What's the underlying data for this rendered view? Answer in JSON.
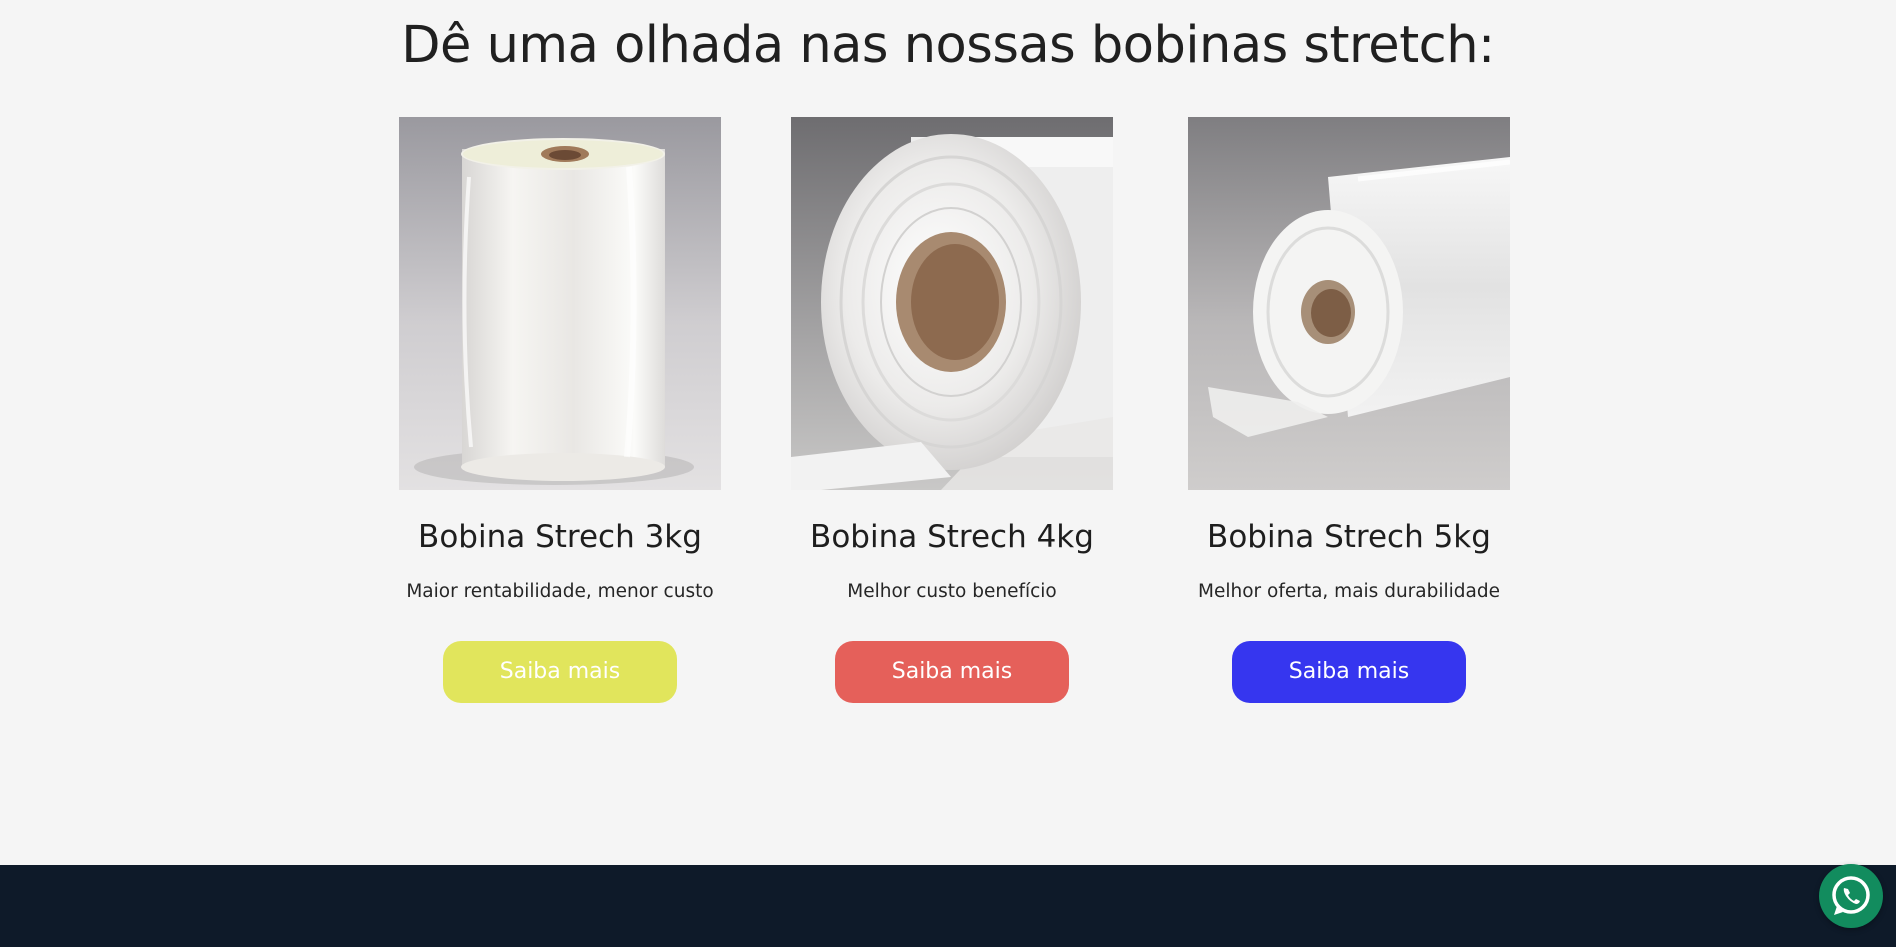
{
  "section": {
    "heading": "Dê uma olhada nas nossas bobinas stretch:"
  },
  "products": [
    {
      "name": "Bobina Strech 3kg",
      "description": "Maior rentabilidade, menor custo",
      "button_label": "Saiba mais",
      "button_color": "#e1e55c",
      "image_icon": "upright-stretch-film-roll"
    },
    {
      "name": "Bobina Strech 4kg",
      "description": "Melhor custo benefício",
      "button_label": "Saiba mais",
      "button_color": "#e5605a",
      "image_icon": "stretch-film-roll-front-view"
    },
    {
      "name": "Bobina Strech 5kg",
      "description": "Melhor oferta, mais durabilidade",
      "button_label": "Saiba mais",
      "button_color": "#3636ef",
      "image_icon": "lying-stretch-film-roll"
    }
  ],
  "footer": {
    "background": "#0e1a29"
  },
  "floating_action": {
    "icon": "whatsapp-icon",
    "color": "#128c5e"
  }
}
